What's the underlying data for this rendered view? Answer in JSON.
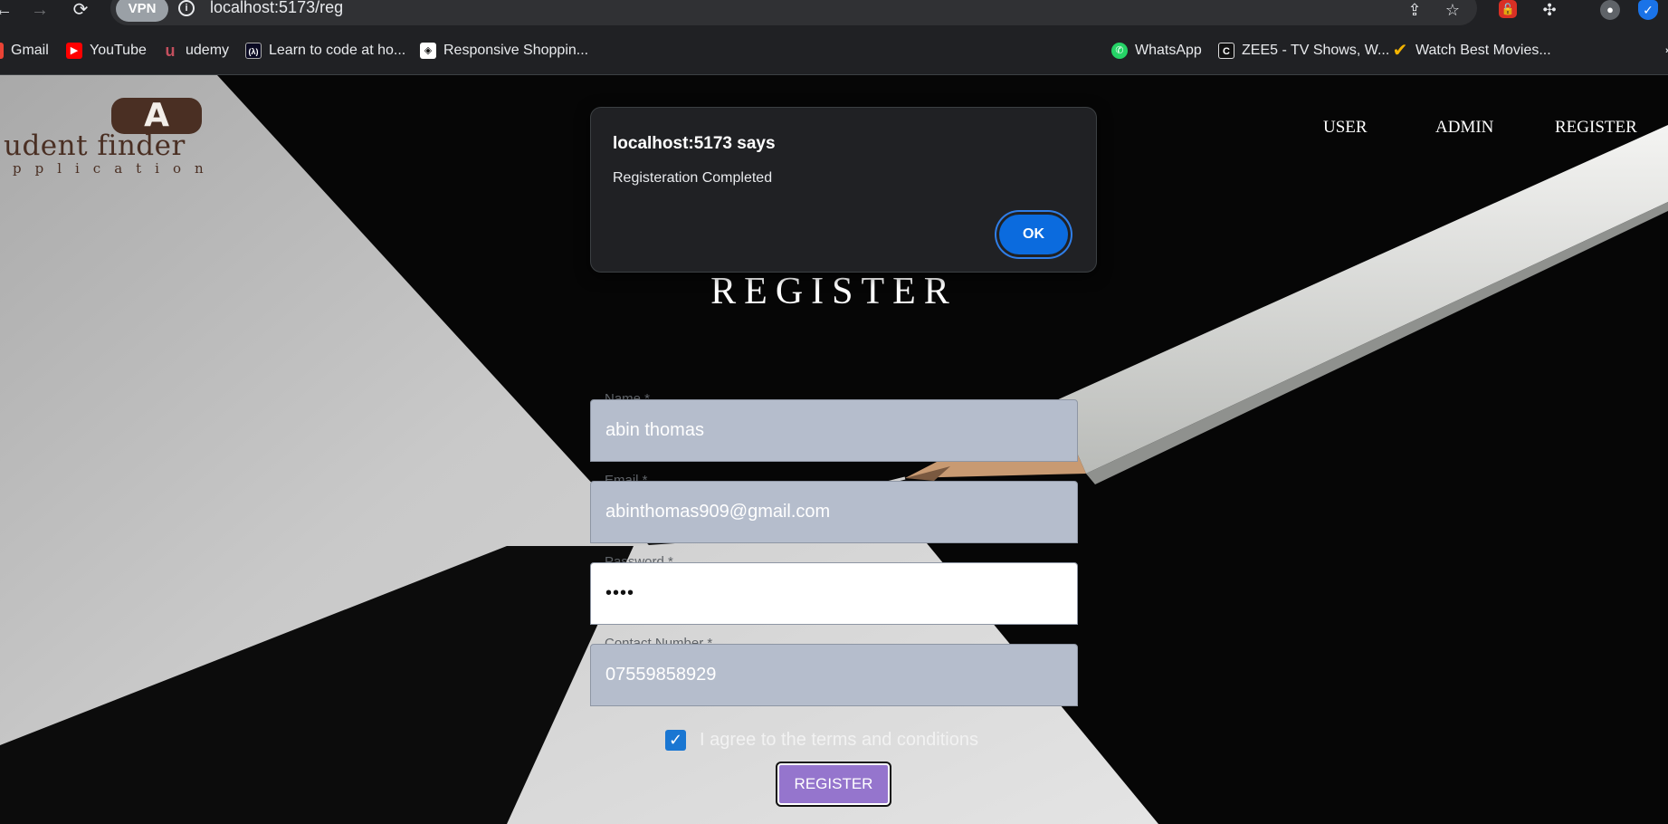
{
  "browser": {
    "url": "localhost:5173/reg",
    "vpn_label": "VPN",
    "bookmarks": [
      {
        "label": "Gmail",
        "icon": "gmail-icon"
      },
      {
        "label": "YouTube",
        "icon": "youtube-icon"
      },
      {
        "label": "udemy",
        "icon": "udemy-icon"
      },
      {
        "label": "Learn to code at ho...",
        "icon": "freecodecamp-icon"
      },
      {
        "label": "Responsive Shoppin...",
        "icon": "codepen-icon"
      },
      {
        "label": "WhatsApp",
        "icon": "whatsapp-icon"
      },
      {
        "label": "ZEE5 - TV Shows, W...",
        "icon": "zee5-icon"
      },
      {
        "label": "Watch Best Movies...",
        "icon": "checkmark-icon"
      }
    ]
  },
  "logo": {
    "glyph": "A",
    "line1": "udent finder",
    "line2": "pplication"
  },
  "nav": {
    "user": "USER",
    "admin": "ADMIN",
    "register": "REGISTER"
  },
  "form": {
    "title": "REGISTER",
    "name_label": "Name *",
    "name_value": "abin thomas",
    "email_label": "Email *",
    "email_value": "abinthomas909@gmail.com",
    "password_label": "Password *",
    "password_value": "••••",
    "contact_label": "Contact Number *",
    "contact_value": "07559858929",
    "terms_checked": true,
    "terms_label": "I agree to the terms and conditions",
    "submit_label": "REGISTER"
  },
  "dialog": {
    "title": "localhost:5173 says",
    "message": "Registeration Completed",
    "ok_label": "OK"
  },
  "colors": {
    "field_bg": "#b5bdcc",
    "button_bg": "#9575cd",
    "dialog_bg": "#202124",
    "ok_bg": "#0b6bde",
    "checkbox": "#1976d2",
    "logo_brown": "#4a2f23"
  }
}
